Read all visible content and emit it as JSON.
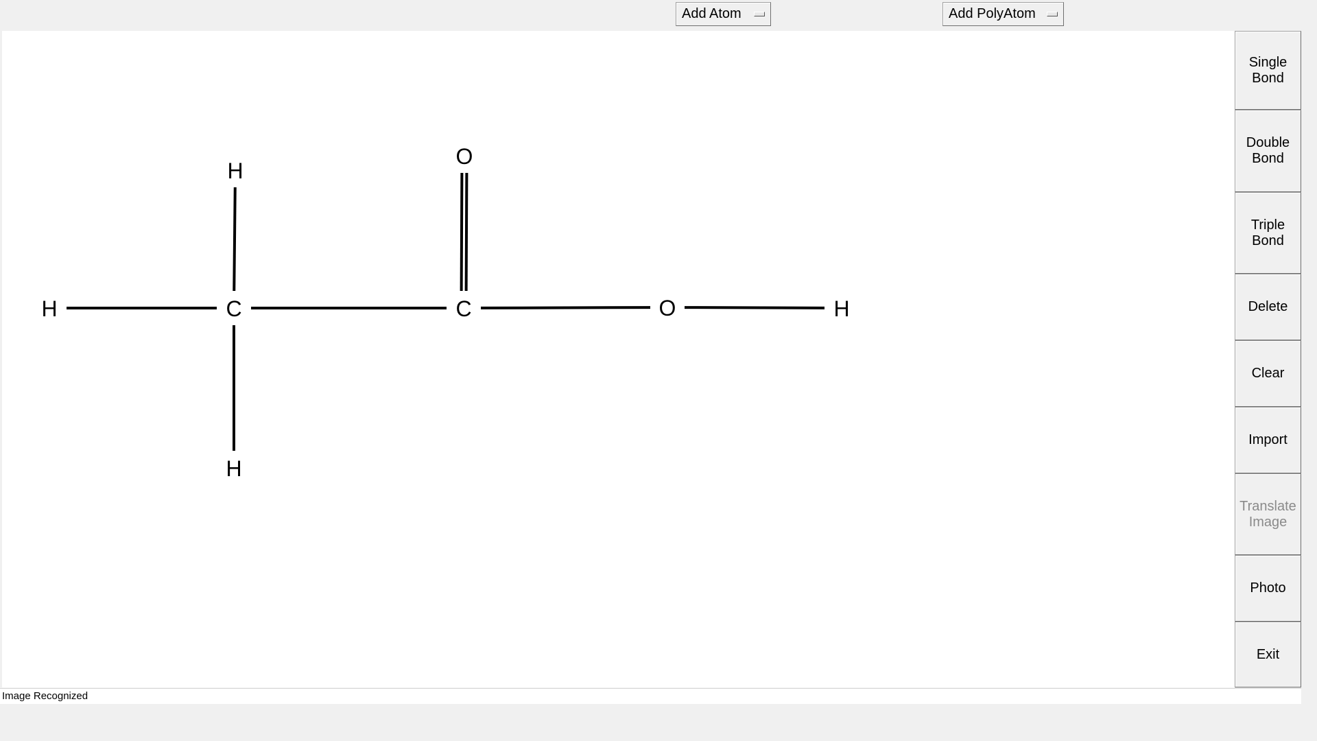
{
  "toolbar": {
    "add_atom_label": "Add Atom",
    "add_polyatom_label": "Add PolyAtom"
  },
  "sidebar": {
    "buttons": [
      {
        "label": "Single\nBond",
        "enabled": true
      },
      {
        "label": "Double\nBond",
        "enabled": true
      },
      {
        "label": "Triple\nBond",
        "enabled": true
      },
      {
        "label": "Delete",
        "enabled": true
      },
      {
        "label": "Clear",
        "enabled": true
      },
      {
        "label": "Import",
        "enabled": true
      },
      {
        "label": "Translate\nImage",
        "enabled": false
      },
      {
        "label": "Photo",
        "enabled": true
      },
      {
        "label": "Exit",
        "enabled": true
      }
    ]
  },
  "molecule": {
    "atoms": [
      {
        "id": "h1",
        "symbol": "H"
      },
      {
        "id": "c1",
        "symbol": "C"
      },
      {
        "id": "h2",
        "symbol": "H"
      },
      {
        "id": "h3",
        "symbol": "H"
      },
      {
        "id": "c2",
        "symbol": "C"
      },
      {
        "id": "o1",
        "symbol": "O"
      },
      {
        "id": "o2",
        "symbol": "O"
      },
      {
        "id": "h4",
        "symbol": "H"
      }
    ],
    "bonds": [
      {
        "from": "h1",
        "to": "c1",
        "order": 1
      },
      {
        "from": "c1",
        "to": "h2",
        "order": 1
      },
      {
        "from": "c1",
        "to": "h3",
        "order": 1
      },
      {
        "from": "c1",
        "to": "c2",
        "order": 1
      },
      {
        "from": "c2",
        "to": "o1",
        "order": 2
      },
      {
        "from": "c2",
        "to": "o2",
        "order": 1
      },
      {
        "from": "o2",
        "to": "h4",
        "order": 1
      }
    ]
  },
  "status": {
    "text": "Image Recognized"
  },
  "colors": {
    "window_bg": "#f0f0f0",
    "canvas_bg": "#ffffff",
    "bond": "#000000",
    "disabled_text": "#8a8a8a"
  }
}
